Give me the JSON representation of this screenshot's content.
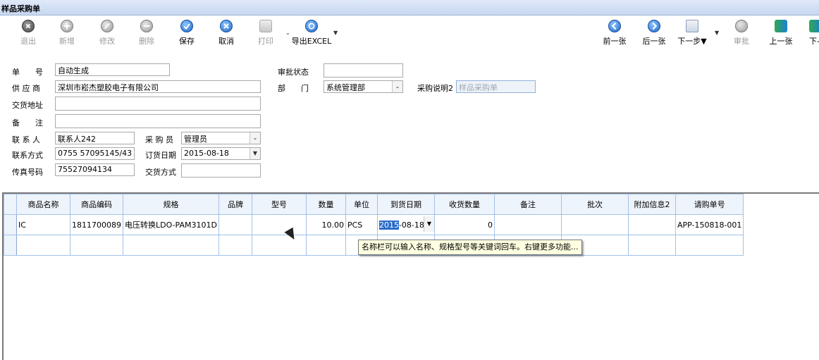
{
  "window": {
    "title": "样品采购单"
  },
  "toolbar": {
    "exit": "退出",
    "new": "新增",
    "edit": "修改",
    "delete": "删除",
    "save": "保存",
    "cancel": "取消",
    "print": "打印",
    "export": "导出EXCEL",
    "prev": "前一张",
    "next": "后一张",
    "next_step": "下一步▼",
    "approve": "审批",
    "up": "上一张",
    "down_partial": "下-"
  },
  "form": {
    "order_no_label": "单　　号",
    "order_no": "自动生成",
    "supplier_label": "供 应 商",
    "supplier": "深圳市崧杰塑胶电子有限公司",
    "delivery_addr_label": "交货地址",
    "delivery_addr": "",
    "remark_label": "备　　注",
    "remark": "",
    "contact_label": "联 系 人",
    "contact": "联系人242",
    "phone_label": "联系方式",
    "phone": "0755 57095145/43",
    "fax_label": "传真号码",
    "fax": "75527094134",
    "approval_label": "审批状态",
    "approval": "",
    "dept_label": "部　　门",
    "dept": "系统管理部",
    "desc2_label": "采购说明2",
    "desc2": "样品采购单",
    "buyer_label": "采 购 员",
    "buyer": "管理员",
    "order_date_label": "订货日期",
    "order_date": "2015-08-18",
    "delivery_mode_label": "交货方式",
    "delivery_mode": ""
  },
  "grid": {
    "headers": [
      "商品名称",
      "商品编码",
      "规格",
      "品牌",
      "型号",
      "数量",
      "单位",
      "到货日期",
      "收货数量",
      "备注",
      "批次",
      "附加信息2",
      "请购单号"
    ],
    "rows": [
      {
        "name": "IC",
        "code": "1811700089",
        "spec": "电压转换LDO-PAM3101D",
        "brand": "",
        "model": "",
        "qty": "10.00",
        "unit": "PCS",
        "date_hl": "2015",
        "date_rest": "-08-18",
        "recv": "0",
        "remark": "",
        "batch": "",
        "extra": "",
        "req": "APP-150818-001"
      }
    ]
  },
  "tooltip": "名称栏可以输入名称、规格型号等关键词回车。右键更多功能..."
}
